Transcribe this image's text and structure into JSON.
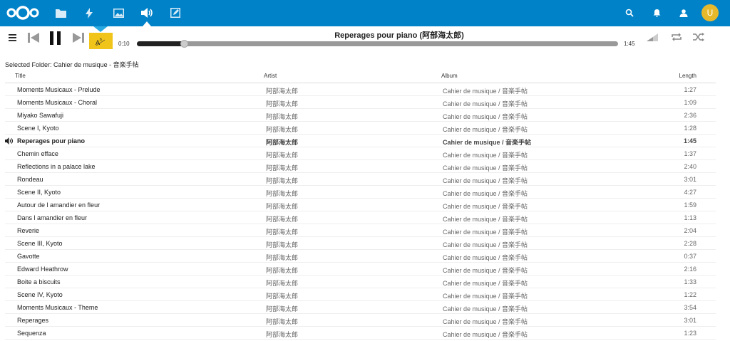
{
  "nav": {
    "apps": [
      {
        "name": "files-app-icon",
        "icon": "folder-icon"
      },
      {
        "name": "activity-app-icon",
        "icon": "bolt-icon"
      },
      {
        "name": "gallery-app-icon",
        "icon": "image-icon"
      },
      {
        "name": "music-app-icon",
        "icon": "speaker-icon",
        "active": true
      },
      {
        "name": "notes-app-icon",
        "icon": "edit-icon"
      }
    ],
    "avatar_initial": "U",
    "brand_color": "#0082c9",
    "avatar_color": "#e6b92d"
  },
  "player": {
    "song_title": "Reperages pour piano (阿部海太郎)",
    "elapsed": "0:10",
    "duration": "1:45",
    "progress_fraction": 0.095
  },
  "folder": {
    "label": "Selected Folder: Cahier de musique - 音楽手帖"
  },
  "table": {
    "headers": {
      "title": "Title",
      "artist": "Artist",
      "album": "Album",
      "length": "Length"
    },
    "rows": [
      {
        "title": "Moments Musicaux - Prelude",
        "artist": "阿部海太郎",
        "album": "Cahier de musique / 音楽手帖",
        "length": "1:27"
      },
      {
        "title": "Moments Musicaux - Choral",
        "artist": "阿部海太郎",
        "album": "Cahier de musique / 音楽手帖",
        "length": "1:09"
      },
      {
        "title": "Miyako Sawafuji",
        "artist": "阿部海太郎",
        "album": "Cahier de musique / 音楽手帖",
        "length": "2:36"
      },
      {
        "title": "Scene I, Kyoto",
        "artist": "阿部海太郎",
        "album": "Cahier de musique / 音楽手帖",
        "length": "1:28"
      },
      {
        "title": "Reperages pour piano",
        "artist": "阿部海太郎",
        "album": "Cahier de musique / 音楽手帖",
        "length": "1:45",
        "playing": true
      },
      {
        "title": "Chemin efface",
        "artist": "阿部海太郎",
        "album": "Cahier de musique / 音楽手帖",
        "length": "1:37"
      },
      {
        "title": "Reflections in a palace lake",
        "artist": "阿部海太郎",
        "album": "Cahier de musique / 音楽手帖",
        "length": "2:40"
      },
      {
        "title": "Rondeau",
        "artist": "阿部海太郎",
        "album": "Cahier de musique / 音楽手帖",
        "length": "3:01"
      },
      {
        "title": "Scene II, Kyoto",
        "artist": "阿部海太郎",
        "album": "Cahier de musique / 音楽手帖",
        "length": "4:27"
      },
      {
        "title": "Autour de l amandier en fleur",
        "artist": "阿部海太郎",
        "album": "Cahier de musique / 音楽手帖",
        "length": "1:59"
      },
      {
        "title": "Dans l amandier en fleur",
        "artist": "阿部海太郎",
        "album": "Cahier de musique / 音楽手帖",
        "length": "1:13"
      },
      {
        "title": "Reverie",
        "artist": "阿部海太郎",
        "album": "Cahier de musique / 音楽手帖",
        "length": "2:04"
      },
      {
        "title": "Scene III, Kyoto",
        "artist": "阿部海太郎",
        "album": "Cahier de musique / 音楽手帖",
        "length": "2:28"
      },
      {
        "title": "Gavotte",
        "artist": "阿部海太郎",
        "album": "Cahier de musique / 音楽手帖",
        "length": "0:37"
      },
      {
        "title": "Edward Heathrow",
        "artist": "阿部海太郎",
        "album": "Cahier de musique / 音楽手帖",
        "length": "2:16"
      },
      {
        "title": "Boite a biscuits",
        "artist": "阿部海太郎",
        "album": "Cahier de musique / 音楽手帖",
        "length": "1:33"
      },
      {
        "title": "Scene IV, Kyoto",
        "artist": "阿部海太郎",
        "album": "Cahier de musique / 音楽手帖",
        "length": "1:22"
      },
      {
        "title": "Moments Musicaux - Theme",
        "artist": "阿部海太郎",
        "album": "Cahier de musique / 音楽手帖",
        "length": "3:54"
      },
      {
        "title": "Reperages",
        "artist": "阿部海太郎",
        "album": "Cahier de musique / 音楽手帖",
        "length": "3:01"
      },
      {
        "title": "Sequenza",
        "artist": "阿部海太郎",
        "album": "Cahier de musique / 音楽手帖",
        "length": "1:23"
      }
    ]
  }
}
